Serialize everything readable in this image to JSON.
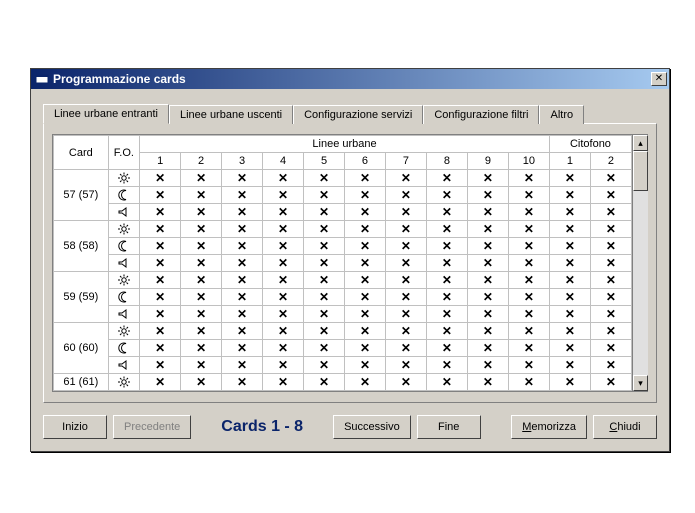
{
  "window": {
    "title": "Programmazione cards"
  },
  "tabs": [
    {
      "label": "Linee urbane entranti",
      "active": true
    },
    {
      "label": "Linee urbane uscenti",
      "active": false
    },
    {
      "label": "Configurazione servizi",
      "active": false
    },
    {
      "label": "Configurazione filtri",
      "active": false
    },
    {
      "label": "Altro",
      "active": false
    }
  ],
  "grid": {
    "headers": {
      "card": "Card",
      "fo": "F.O.",
      "linee_urbane": "Linee urbane",
      "citofono": "Citofono",
      "line_cols": [
        "1",
        "2",
        "3",
        "4",
        "5",
        "6",
        "7",
        "8",
        "9",
        "10"
      ],
      "cit_cols": [
        "1",
        "2"
      ]
    },
    "fo_modes": [
      "sun",
      "moon",
      "bell"
    ],
    "cards": [
      {
        "label": "57 (57)"
      },
      {
        "label": "58 (58)"
      },
      {
        "label": "59 (59)"
      },
      {
        "label": "60 (60)"
      },
      {
        "label": "61 (61)"
      }
    ],
    "cell_mark": "✕"
  },
  "footer": {
    "inizio": "Inizio",
    "precedente": "Precedente",
    "range": "Cards  1 - 8",
    "successivo": "Successivo",
    "fine": "Fine",
    "memorizza": "Memorizza",
    "chiudi": "Chiudi",
    "memorizza_ul": "M",
    "chiudi_ul": "C"
  },
  "chart_data": {
    "type": "table",
    "title": "Linee urbane entranti",
    "row_labels": [
      "57 (57)",
      "58 (58)",
      "59 (59)",
      "60 (60)",
      "61 (61)"
    ],
    "row_modes_per_card": [
      "sun",
      "moon",
      "bell"
    ],
    "column_groups": {
      "Linee urbane": [
        "1",
        "2",
        "3",
        "4",
        "5",
        "6",
        "7",
        "8",
        "9",
        "10"
      ],
      "Citofono": [
        "1",
        "2"
      ]
    },
    "note": "Every visible cell is marked (X). 61 (61) shows only the 'sun' row; remaining rows are below the scroll viewport.",
    "values": "all_marked"
  }
}
